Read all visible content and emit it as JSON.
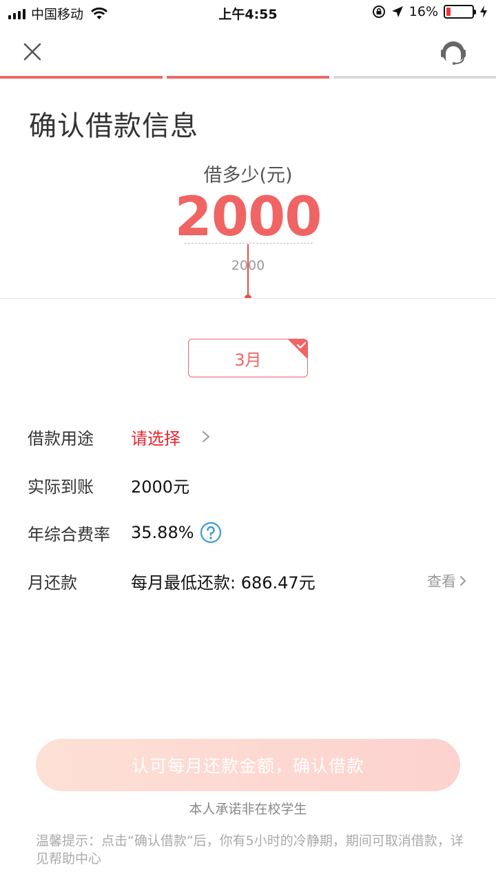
{
  "status_bar": {
    "carrier": "中国移动",
    "time": "上午4:55",
    "battery_percent": "16%",
    "battery_level": 0.16
  },
  "progress": {
    "total_steps": 3,
    "completed_steps": 2,
    "active_color": "#ee6a6a",
    "inactive_color": "#d9d9d9"
  },
  "page": {
    "title": "确认借款信息"
  },
  "amount": {
    "label": "借多少(元)",
    "value": "2000",
    "ruler_tick": "2000"
  },
  "term": {
    "selected": "3月"
  },
  "details": {
    "purpose_label": "借款用途",
    "purpose_value": "请选择",
    "received_label": "实际到账",
    "received_value": "2000元",
    "rate_label": "年综合费率",
    "rate_value": "35.88%",
    "monthly_label": "月还款",
    "monthly_value": "每月最低还款: 686.47元",
    "view_label": "查看"
  },
  "actions": {
    "confirm_label": "认可每月还款金额，确认借款"
  },
  "footer": {
    "promise": "本人承诺非在校学生",
    "tip": "温馨提示：点击“确认借款”后，你有5小时的冷静期，期间可取消借款，详见帮助中心"
  },
  "colors": {
    "accent": "#f06464",
    "accent_red": "#e8242c",
    "help_blue": "#3a9ad9"
  }
}
